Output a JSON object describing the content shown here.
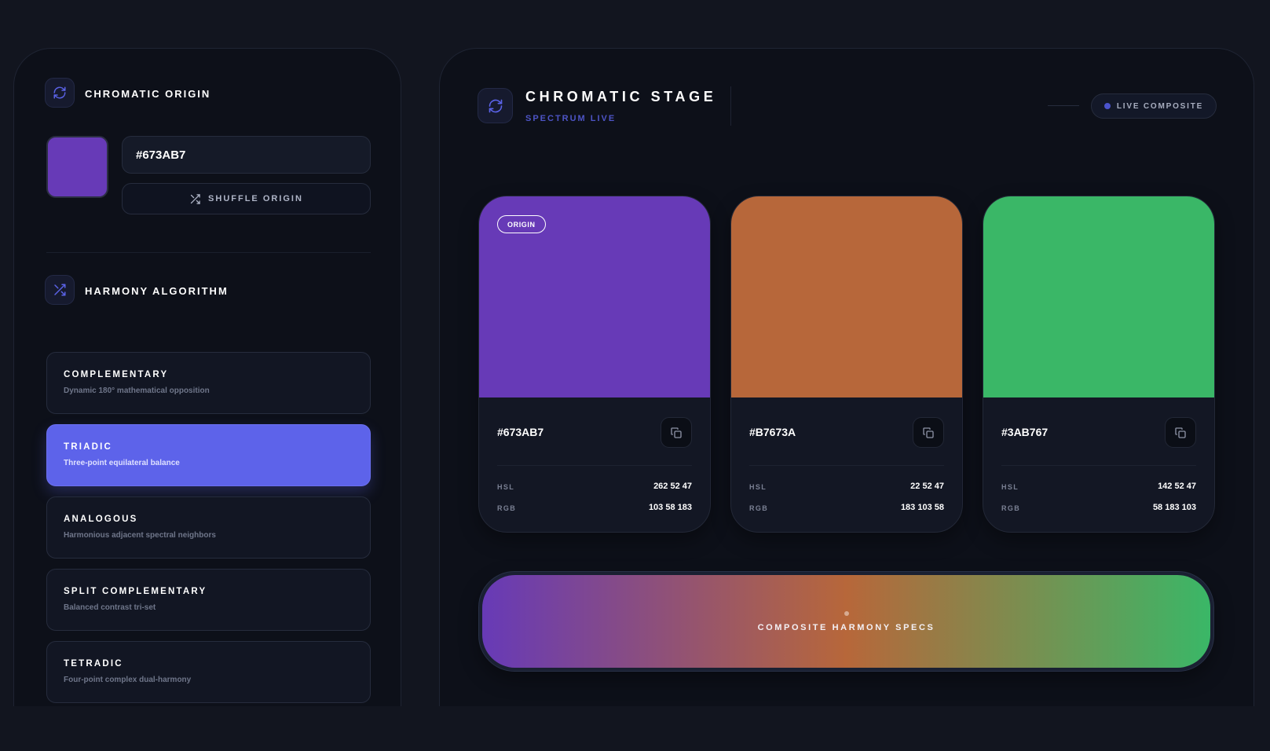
{
  "origin_panel": {
    "title": "CHROMATIC ORIGIN",
    "hex_value": "#673AB7",
    "swatch_color": "#673AB7",
    "shuffle_label": "SHUFFLE ORIGIN"
  },
  "harmony_panel": {
    "title": "HARMONY ALGORITHM",
    "algorithms": [
      {
        "name": "COMPLEMENTARY",
        "description": "Dynamic 180° mathematical opposition",
        "active": false
      },
      {
        "name": "TRIADIC",
        "description": "Three-point equilateral balance",
        "active": true
      },
      {
        "name": "ANALOGOUS",
        "description": "Harmonious adjacent spectral neighbors",
        "active": false
      },
      {
        "name": "SPLIT COMPLEMENTARY",
        "description": "Balanced contrast tri-set",
        "active": false
      },
      {
        "name": "TETRADIC",
        "description": "Four-point complex dual-harmony",
        "active": false
      }
    ]
  },
  "stage": {
    "title": "CHROMATIC STAGE",
    "subtitle": "SPECTRUM LIVE",
    "live_badge": "LIVE COMPOSITE",
    "accent_color": "#4b53cc"
  },
  "cards": [
    {
      "hex": "#673AB7",
      "color": "#673AB7",
      "tag": "ORIGIN",
      "hsl_label": "HSL",
      "hsl": "262 52 47",
      "rgb_label": "RGB",
      "rgb": "103 58 183"
    },
    {
      "hex": "#B7673A",
      "color": "#B7673A",
      "tag": "",
      "hsl_label": "HSL",
      "hsl": "22 52 47",
      "rgb_label": "RGB",
      "rgb": "183 103 58"
    },
    {
      "hex": "#3AB767",
      "color": "#3AB767",
      "tag": "",
      "hsl_label": "HSL",
      "hsl": "142 52 47",
      "rgb_label": "RGB",
      "rgb": "58 183 103"
    }
  ],
  "composite": {
    "label": "COMPOSITE HARMONY SPECS",
    "colors": [
      "#673AB7",
      "#B7673A",
      "#3AB767"
    ]
  },
  "icons": {
    "origin": "refresh-icon",
    "harmony": "shuffle-icon",
    "stage": "refresh-icon",
    "shuffle_button": "shuffle-icon",
    "copy": "copy-icon"
  }
}
